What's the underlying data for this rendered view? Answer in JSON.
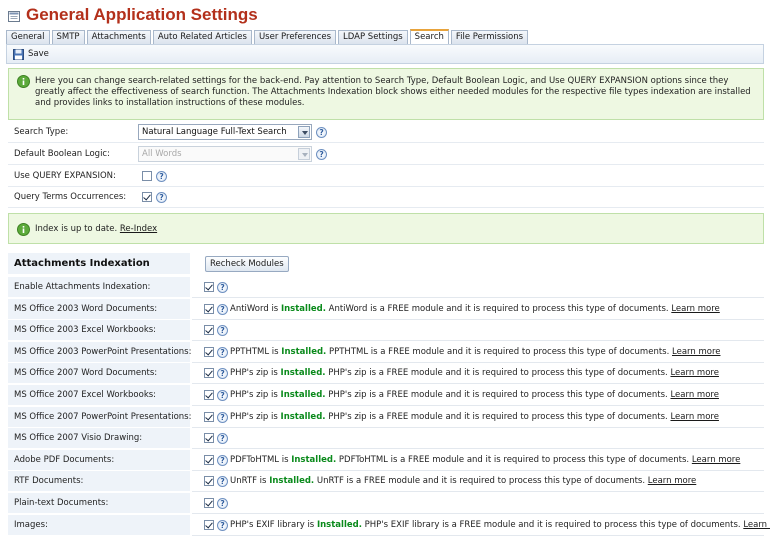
{
  "page": {
    "title": "General Application Settings"
  },
  "tabs": [
    {
      "label": "General"
    },
    {
      "label": "SMTP"
    },
    {
      "label": "Attachments"
    },
    {
      "label": "Auto Related Articles"
    },
    {
      "label": "User Preferences"
    },
    {
      "label": "LDAP Settings"
    },
    {
      "label": "Search",
      "active": true
    },
    {
      "label": "File Permissions"
    }
  ],
  "toolbar": {
    "save_label": "Save"
  },
  "info": {
    "text": "Here you can change search-related settings for the back-end. Pay attention to Search Type, Default Boolean Logic, and Use QUERY EXPANSION options since they greatly affect the effectiveness of search function. The Attachments Indexation block shows either needed modules for the respective file types indexation are installed and provides links to installation instructions of these modules."
  },
  "search_form": {
    "search_type_label": "Search Type:",
    "search_type_value": "Natural Language Full-Text Search",
    "boolean_logic_label": "Default Boolean Logic:",
    "boolean_logic_value": "All Words",
    "query_expansion_label": "Use QUERY EXPANSION:",
    "query_expansion_checked": false,
    "query_terms_label": "Query Terms Occurrences:",
    "query_terms_checked": true
  },
  "index_status": {
    "text": "Index is up to date.",
    "link": "Re-Index"
  },
  "attachments": {
    "title": "Attachments Indexation",
    "recheck_label": "Recheck Modules",
    "learn_more": "Learn more",
    "rows": [
      {
        "label": "Enable Attachments Indexation:",
        "checked": true,
        "module": "",
        "status": "",
        "desc": ""
      },
      {
        "label": "MS Office 2003 Word Documents:",
        "checked": true,
        "module": "AntiWord is",
        "status": "Installed.",
        "desc": "AntiWord is a FREE module and it is required to process this type of documents."
      },
      {
        "label": "MS Office 2003 Excel Workbooks:",
        "checked": true,
        "module": "",
        "status": "",
        "desc": ""
      },
      {
        "label": "MS Office 2003 PowerPoint Presentations:",
        "checked": true,
        "module": "PPTHTML is",
        "status": "Installed.",
        "desc": "PPTHTML is a FREE module and it is required to process this type of documents."
      },
      {
        "label": "MS Office 2007 Word Documents:",
        "checked": true,
        "module": "PHP's zip is",
        "status": "Installed.",
        "desc": "PHP's zip is a FREE module and it is required to process this type of documents."
      },
      {
        "label": "MS Office 2007 Excel Workbooks:",
        "checked": true,
        "module": "PHP's zip is",
        "status": "Installed.",
        "desc": "PHP's zip is a FREE module and it is required to process this type of documents."
      },
      {
        "label": "MS Office 2007 PowerPoint Presentations:",
        "checked": true,
        "module": "PHP's zip is",
        "status": "Installed.",
        "desc": "PHP's zip is a FREE module and it is required to process this type of documents."
      },
      {
        "label": "MS Office 2007 Visio Drawing:",
        "checked": true,
        "module": "",
        "status": "",
        "desc": ""
      },
      {
        "label": "Adobe PDF Documents:",
        "checked": true,
        "module": "PDFToHTML is",
        "status": "Installed.",
        "desc": "PDFToHTML is a FREE module and it is required to process this type of documents."
      },
      {
        "label": "RTF Documents:",
        "checked": true,
        "module": "UnRTF is",
        "status": "Installed.",
        "desc": "UnRTF is a FREE module and it is required to process this type of documents."
      },
      {
        "label": "Plain-text Documents:",
        "checked": true,
        "module": "",
        "status": "",
        "desc": ""
      },
      {
        "label": "Images:",
        "checked": true,
        "module": "PHP's EXIF library is",
        "status": "Installed.",
        "desc": "PHP's EXIF library is a FREE module and it is required to process this type of documents."
      }
    ]
  },
  "colors": {
    "title": "#b3301b",
    "installed": "#0a8a1b",
    "info_bg": "#eef8e2",
    "section_bg": "#eef3f9"
  }
}
